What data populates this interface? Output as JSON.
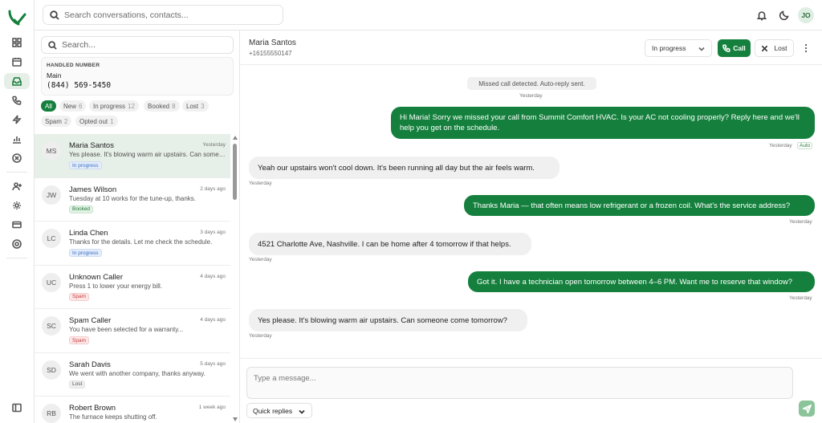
{
  "top": {
    "search_placeholder": "Search conversations, contacts...",
    "user_initials": "JO"
  },
  "panel": {
    "search_placeholder": "Search...",
    "handled_label": "HANDLED NUMBER",
    "handled_name": "Main",
    "handled_number": "(844) 569-5450",
    "filters": [
      {
        "label": "All",
        "count": ""
      },
      {
        "label": "New",
        "count": "6"
      },
      {
        "label": "In progress",
        "count": "12"
      },
      {
        "label": "Booked",
        "count": "8"
      },
      {
        "label": "Lost",
        "count": "3"
      },
      {
        "label": "Spam",
        "count": "2"
      },
      {
        "label": "Opted out",
        "count": "1"
      }
    ],
    "conversations": [
      {
        "initials": "MS",
        "name": "Maria Santos",
        "time": "Yesterday",
        "preview": "Yes please. It's blowing warm air upstairs. Can someone come tomorrow?",
        "badge": "In progress"
      },
      {
        "initials": "JW",
        "name": "James Wilson",
        "time": "2 days ago",
        "preview": "Tuesday at 10 works for the tune-up, thanks.",
        "badge": "Booked"
      },
      {
        "initials": "LC",
        "name": "Linda Chen",
        "time": "3 days ago",
        "preview": "Thanks for the details. Let me check the schedule.",
        "badge": "In progress"
      },
      {
        "initials": "UC",
        "name": "Unknown Caller",
        "time": "4 days ago",
        "preview": "Press 1 to lower your energy bill.",
        "badge": "Spam"
      },
      {
        "initials": "SC",
        "name": "Spam Caller",
        "time": "4 days ago",
        "preview": "You have been selected for a warranty...",
        "badge": "Spam"
      },
      {
        "initials": "SD",
        "name": "Sarah Davis",
        "time": "5 days ago",
        "preview": "We went with another company, thanks anyway.",
        "badge": "Lost"
      },
      {
        "initials": "RB",
        "name": "Robert Brown",
        "time": "1 week ago",
        "preview": "The furnace keeps shutting off.",
        "badge": ""
      }
    ]
  },
  "chat": {
    "contact_name": "Maria Santos",
    "contact_phone": "+16155550147",
    "status": "In progress",
    "call_label": "Call",
    "lost_label": "Lost",
    "system_message": "Missed call detected. Auto-reply sent.",
    "system_time": "Yesterday",
    "auto_label": "Auto",
    "messages": [
      {
        "dir": "out",
        "text": "Hi Maria! Sorry we missed your call from Summit Comfort HVAC. Is your AC not cooling properly? Reply here and we'll help you get on the schedule.",
        "time": "Yesterday"
      },
      {
        "dir": "in",
        "text": "Yeah our upstairs won't cool down. It's been running all day but the air feels warm.",
        "time": "Yesterday"
      },
      {
        "dir": "out",
        "text": "Thanks Maria — that often means low refrigerant or a frozen coil. What's the service address?",
        "time": "Yesterday"
      },
      {
        "dir": "in",
        "text": "4521 Charlotte Ave, Nashville. I can be home after 4 tomorrow if that helps.",
        "time": "Yesterday"
      },
      {
        "dir": "out",
        "text": "Got it. I have a technician open tomorrow between 4–6 PM. Want me to reserve that window?",
        "time": "Yesterday"
      },
      {
        "dir": "in",
        "text": "Yes please. It's blowing warm air upstairs. Can someone come tomorrow?",
        "time": "Yesterday"
      }
    ],
    "composer_placeholder": "Type a message...",
    "quick_replies_label": "Quick replies"
  },
  "colors": {
    "brand": "#15803d",
    "selected_row": "#e6efe8"
  }
}
